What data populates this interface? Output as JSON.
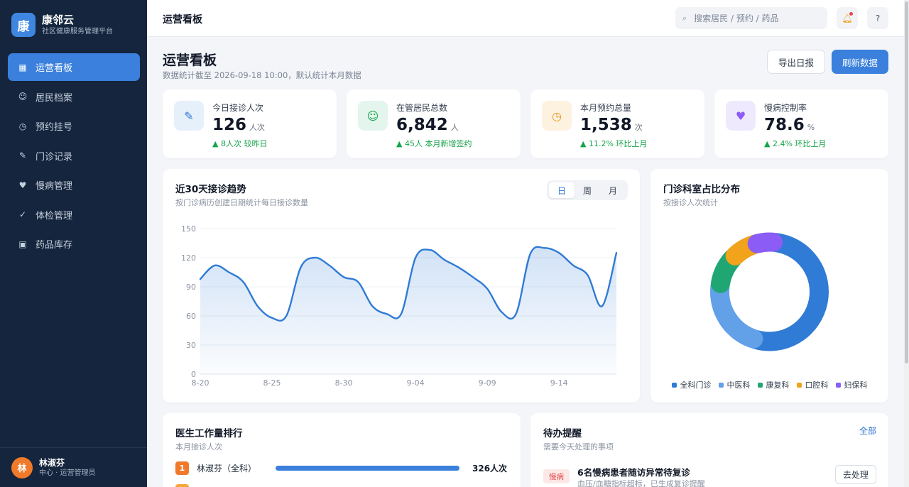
{
  "brand": {
    "logo_char": "康",
    "name": "康邻云",
    "subtitle": "社区健康服务管理平台"
  },
  "sidebar": {
    "items": [
      {
        "label": "运营看板",
        "icon": "grid-icon",
        "glyph": "▦",
        "active": true
      },
      {
        "label": "居民档案",
        "icon": "smile-icon",
        "glyph": "☺",
        "active": false
      },
      {
        "label": "预约挂号",
        "icon": "clock-icon",
        "glyph": "◷",
        "active": false
      },
      {
        "label": "门诊记录",
        "icon": "pen-icon",
        "glyph": "✎",
        "active": false
      },
      {
        "label": "慢病管理",
        "icon": "heart-icon",
        "glyph": "♥",
        "active": false
      },
      {
        "label": "体检管理",
        "icon": "check-icon",
        "glyph": "✓",
        "active": false
      },
      {
        "label": "药品库存",
        "icon": "box-icon",
        "glyph": "▣",
        "active": false
      }
    ]
  },
  "user": {
    "avatar_char": "林",
    "name": "林淑芬",
    "role": "中心 · 运营管理员"
  },
  "topbar": {
    "title": "运营看板",
    "search_placeholder": "搜索居民 / 预约 / 药品",
    "help_label": "?"
  },
  "header": {
    "title": "运营看板",
    "subtitle": "数据统计截至 2026-09-18 10:00，默认统计本月数据",
    "export_label": "导出日报",
    "refresh_label": "刷新数据"
  },
  "stats": [
    {
      "label": "今日接诊人次",
      "value": "126",
      "unit": "人次",
      "trend": "▲ 8人次 较昨日",
      "icon": "pen-icon",
      "glyph": "✎",
      "color": "#2f74d0",
      "bg": "#e6f0fb"
    },
    {
      "label": "在管居民总数",
      "value": "6,842",
      "unit": "人",
      "trend": "▲ 45人 本月新增签约",
      "icon": "smile-icon",
      "glyph": "☺",
      "color": "#16a34a",
      "bg": "#e3f5ec"
    },
    {
      "label": "本月预约总量",
      "value": "1,538",
      "unit": "次",
      "trend": "▲ 11.2% 环比上月",
      "icon": "clock-icon",
      "glyph": "◷",
      "color": "#e49a12",
      "bg": "#fdf1e0"
    },
    {
      "label": "慢病控制率",
      "value": "78.6",
      "unit": "%",
      "trend": "▲ 2.4% 环比上月",
      "icon": "heart-icon",
      "glyph": "♥",
      "color": "#8b5cf6",
      "bg": "#efe9fd"
    }
  ],
  "trend_card": {
    "title": "近30天接诊趋势",
    "subtitle": "按门诊病历创建日期统计每日接诊数量",
    "tabs": [
      "日",
      "周",
      "月"
    ],
    "active_tab": 0
  },
  "donut_card": {
    "title": "门诊科室占比分布",
    "subtitle": "按接诊人次统计"
  },
  "chart_data": [
    {
      "type": "area",
      "x": [
        "8-20",
        "8-21",
        "8-22",
        "8-23",
        "8-24",
        "8-25",
        "8-26",
        "8-27",
        "8-28",
        "8-29",
        "8-30",
        "8-31",
        "9-01",
        "9-02",
        "9-03",
        "9-04",
        "9-05",
        "9-06",
        "9-07",
        "9-08",
        "9-09",
        "9-10",
        "9-11",
        "9-12",
        "9-13",
        "9-14",
        "9-15",
        "9-16",
        "9-17",
        "9-18"
      ],
      "series": [
        {
          "values": [
            98,
            112,
            105,
            95,
            70,
            58,
            60,
            110,
            120,
            112,
            100,
            95,
            70,
            62,
            62,
            120,
            128,
            118,
            110,
            100,
            88,
            64,
            62,
            124,
            130,
            125,
            112,
            102,
            70,
            125
          ]
        }
      ],
      "xticks": [
        "8-20",
        "8-25",
        "8-30",
        "9-04",
        "9-09",
        "9-14"
      ],
      "yticks": [
        0,
        30,
        60,
        90,
        120,
        150
      ],
      "ylim": [
        0,
        150
      ],
      "color": "#2f7bd5",
      "grid": true
    },
    {
      "type": "pie",
      "categories": [
        "全科门诊",
        "中医科",
        "康复科",
        "口腔科",
        "妇保科"
      ],
      "values": [
        52,
        22,
        10,
        8,
        6
      ],
      "colors": [
        "#2f7bd5",
        "#62a0e8",
        "#1fa673",
        "#f0a31b",
        "#8b5cf6"
      ],
      "legend": "bottom"
    }
  ],
  "ranking": {
    "title": "医生工作量排行",
    "subtitle": "本月接诊人次",
    "rows": [
      {
        "rank": "1",
        "name": "林淑芬（全科）",
        "value": "326人次",
        "fraction": 1.0,
        "color": "#f07a2a"
      }
    ]
  },
  "todo": {
    "title": "待办提醒",
    "subtitle": "需要今天处理的事项",
    "all_label": "全部",
    "items": [
      {
        "tag": "慢病",
        "title": "6名慢病患者随访异常待复诊",
        "desc": "血压/血糖指标超标，已生成复诊提醒",
        "action": "去处理"
      }
    ]
  }
}
